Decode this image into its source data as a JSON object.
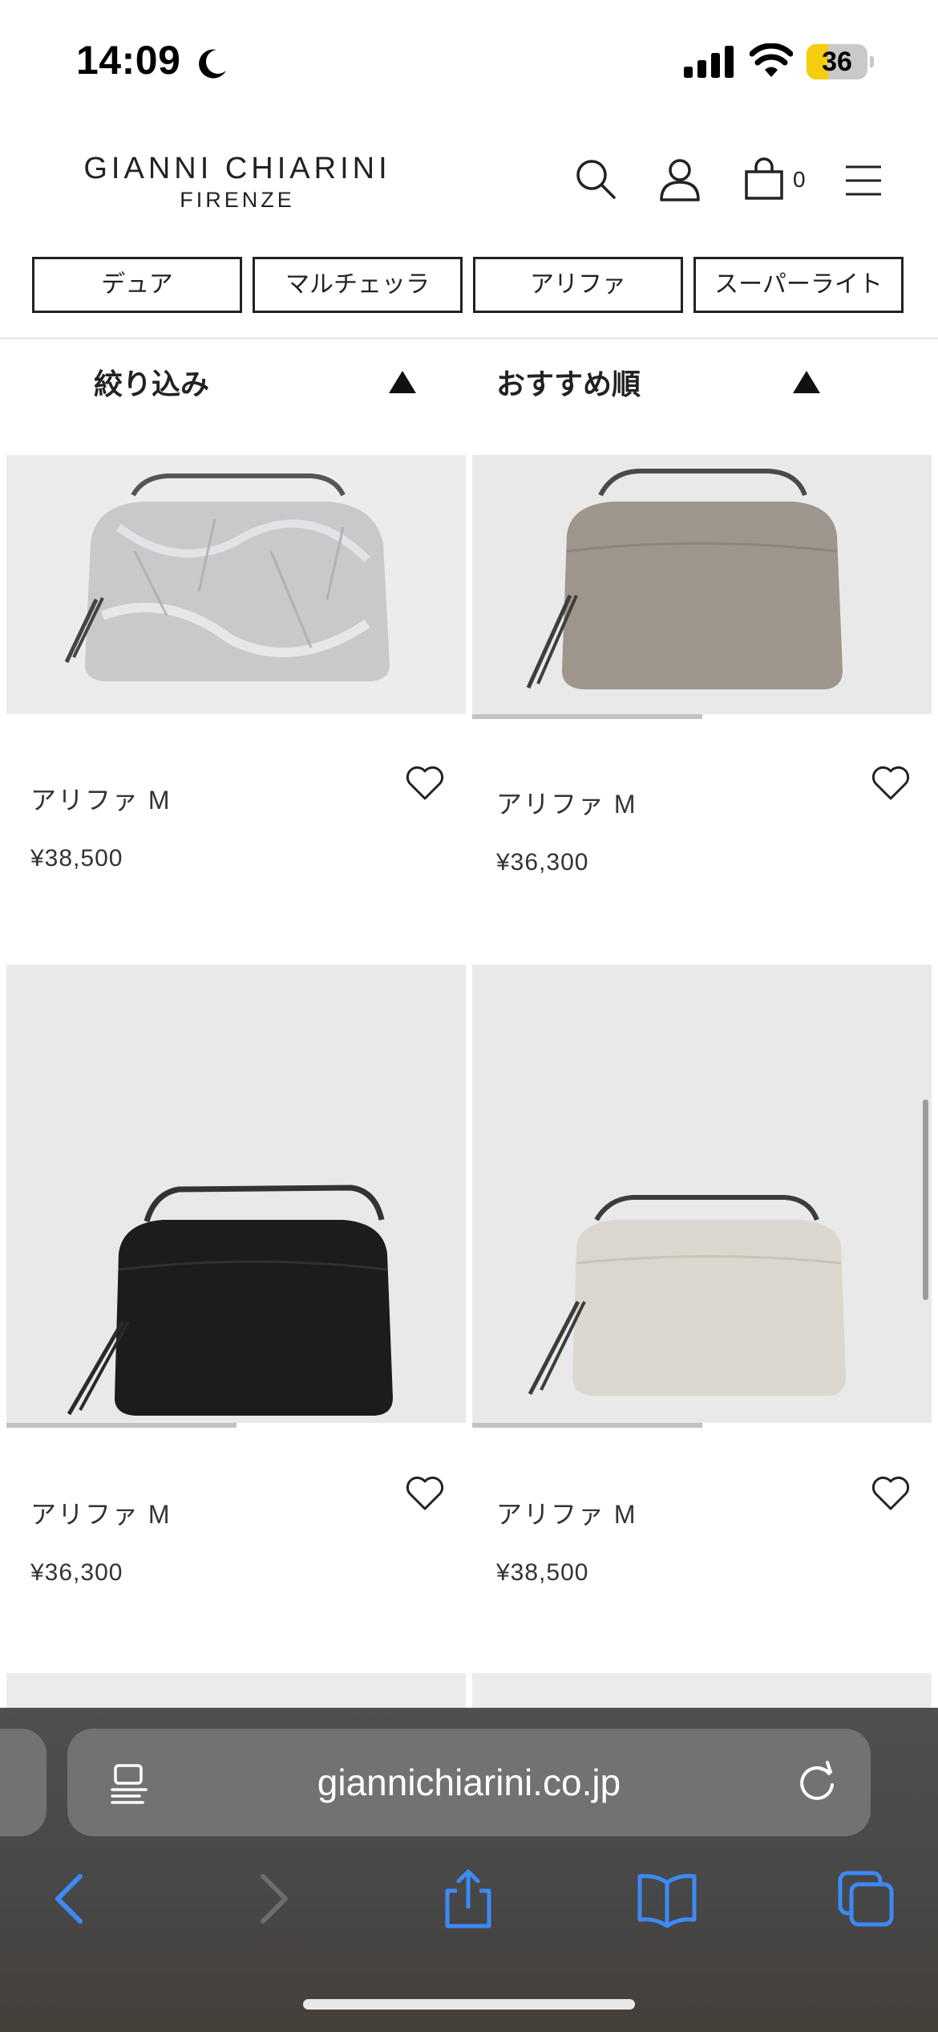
{
  "status_bar": {
    "time": "14:09",
    "battery_level": "36",
    "battery_fraction": 0.36,
    "battery_color": "#f5cd0f",
    "icons": [
      "moon-icon",
      "signal-icon",
      "wifi-icon",
      "battery-icon"
    ]
  },
  "header": {
    "brand_line1": "GIANNI CHIARINI",
    "brand_line2": "FIRENZE",
    "cart_count": "0",
    "icons": [
      "search-icon",
      "account-icon",
      "cart-icon",
      "menu-icon"
    ]
  },
  "category_tabs": [
    "デュア",
    "マルチェッラ",
    "アリファ",
    "スーパーライト"
  ],
  "filter": {
    "refine_label": "絞り込み",
    "sort_label": "おすすめ順"
  },
  "products": [
    {
      "name": "アリファ M",
      "price": "¥38,500",
      "color": "silver",
      "gallery_progress": 0
    },
    {
      "name": "アリファ M",
      "price": "¥36,300",
      "color": "taupe",
      "gallery_progress": 0.5
    },
    {
      "name": "アリファ M",
      "price": "¥36,300",
      "color": "black",
      "gallery_progress": 0.5
    },
    {
      "name": "アリファ M",
      "price": "¥38,500",
      "color": "ivory",
      "gallery_progress": 0.5
    }
  ],
  "browser": {
    "url": "giannichiarini.co.jp",
    "icons": [
      "reader-icon",
      "reload-icon",
      "back-icon",
      "forward-icon",
      "share-icon",
      "bookmarks-icon",
      "tabs-icon"
    ],
    "accent_color": "#3d8af7"
  }
}
